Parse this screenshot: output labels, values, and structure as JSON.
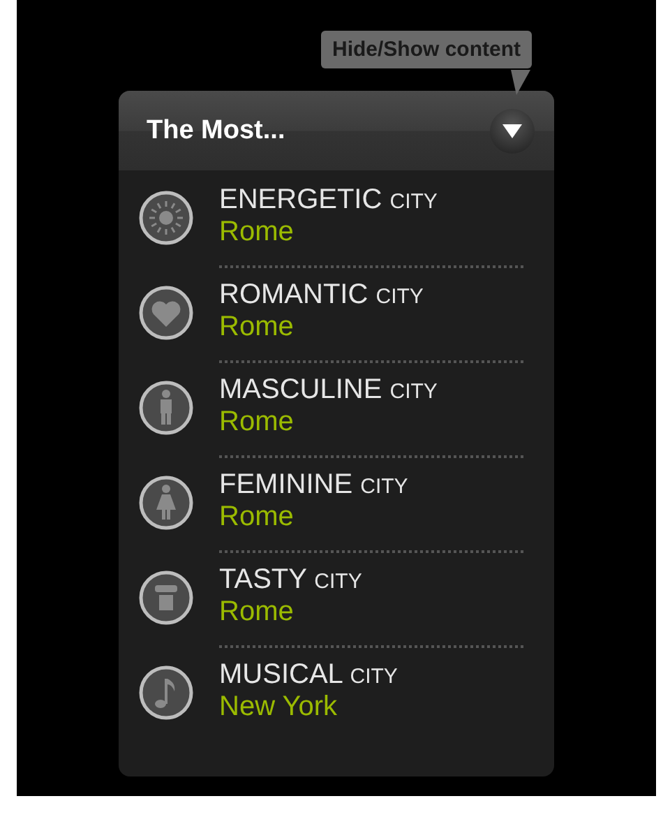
{
  "tooltip": {
    "text": "Hide/Show content"
  },
  "panel": {
    "title": "The Most...",
    "items": [
      {
        "label": "ENERGETIC",
        "suffix": "CITY",
        "city": "Rome"
      },
      {
        "label": "ROMANTIC",
        "suffix": "CITY",
        "city": "Rome"
      },
      {
        "label": "MASCULINE",
        "suffix": "CITY",
        "city": "Rome"
      },
      {
        "label": "FEMININE",
        "suffix": "CITY",
        "city": "Rome"
      },
      {
        "label": "TASTY",
        "suffix": "CITY",
        "city": "Rome"
      },
      {
        "label": "MUSICAL",
        "suffix": "CITY",
        "city": "New York"
      }
    ]
  }
}
